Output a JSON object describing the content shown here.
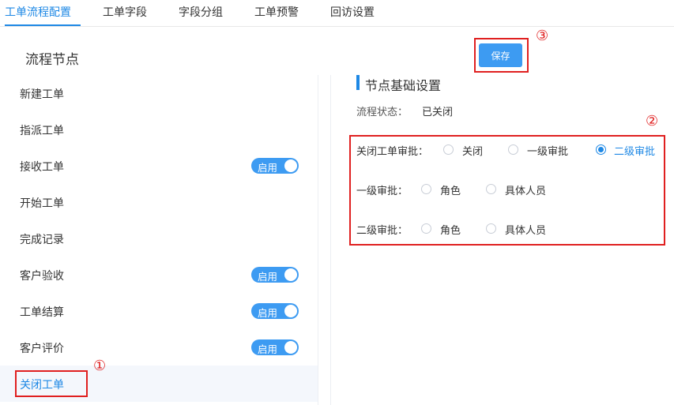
{
  "tabs": [
    {
      "label": "工单流程配置",
      "active": true
    },
    {
      "label": "工单字段",
      "active": false
    },
    {
      "label": "字段分组",
      "active": false
    },
    {
      "label": "工单预警",
      "active": false
    },
    {
      "label": "回访设置",
      "active": false
    }
  ],
  "section_title": "流程节点",
  "save_label": "保存",
  "markers": {
    "m1": "①",
    "m2": "②",
    "m3": "③"
  },
  "nodes": [
    {
      "label": "新建工单"
    },
    {
      "label": "指派工单"
    },
    {
      "label": "接收工单",
      "toggle": "启用"
    },
    {
      "label": "开始工单"
    },
    {
      "label": "完成记录"
    },
    {
      "label": "客户验收",
      "toggle": "启用"
    },
    {
      "label": "工单结算",
      "toggle": "启用"
    },
    {
      "label": "客户评价",
      "toggle": "启用"
    },
    {
      "label": "关闭工单",
      "selected": true
    }
  ],
  "right": {
    "title": "节点基础设置",
    "status_label": "流程状态：",
    "status_value": "已关闭",
    "rows": [
      {
        "label": "关闭工单审批：",
        "options": [
          "关闭",
          "一级审批",
          "二级审批"
        ],
        "selected": 2
      },
      {
        "label": "一级审批：",
        "options": [
          "角色",
          "具体人员"
        ],
        "selected": -1
      },
      {
        "label": "二级审批：",
        "options": [
          "角色",
          "具体人员"
        ],
        "selected": -1
      }
    ]
  },
  "colors": {
    "accent": "#1e88e5",
    "highlight": "#e02020"
  }
}
